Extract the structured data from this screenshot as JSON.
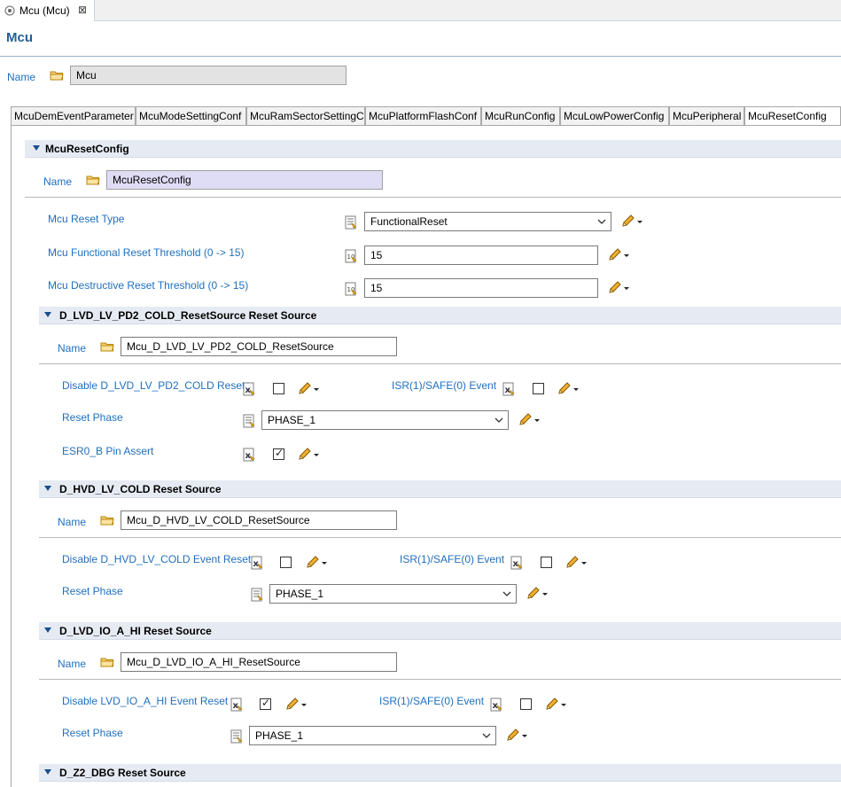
{
  "editor_tab": {
    "title": "Mcu (Mcu)",
    "close_glyph": "⊠"
  },
  "page_title": "Mcu",
  "top_name": {
    "label": "Name",
    "value": "Mcu"
  },
  "subtabs": [
    "McuDemEventParameter",
    "McuModeSettingConf",
    "McuRamSectorSettingC",
    "McuPlatformFlashConf",
    "McuRunConfig",
    "McuLowPowerConfig",
    "McuPeripheral",
    "McuResetConfig"
  ],
  "reset_config": {
    "header": "McuResetConfig",
    "name_label": "Name",
    "name_value": "McuResetConfig",
    "reset_type_label": "Mcu Reset Type",
    "reset_type_value": "FunctionalReset",
    "functional_threshold_label": "Mcu Functional Reset Threshold (0 -> 15)",
    "functional_threshold_value": "15",
    "destructive_threshold_label": "Mcu Destructive Reset Threshold (0 -> 15)",
    "destructive_threshold_value": "15"
  },
  "sections": [
    {
      "header": "D_LVD_LV_PD2_COLD_ResetSource Reset Source",
      "name_label": "Name",
      "name_value": "Mcu_D_LVD_LV_PD2_COLD_ResetSource",
      "disable_label": "Disable D_LVD_LV_PD2_COLD Reset",
      "disable_checked": false,
      "isr_label": "ISR(1)/SAFE(0) Event",
      "isr_checked": false,
      "phase_label": "Reset Phase",
      "phase_value": "PHASE_1",
      "esr_label": "ESR0_B Pin Assert",
      "esr_checked": true
    },
    {
      "header": "D_HVD_LV_COLD Reset Source",
      "name_label": "Name",
      "name_value": "Mcu_D_HVD_LV_COLD_ResetSource",
      "disable_label": "Disable D_HVD_LV_COLD Event Reset",
      "disable_checked": false,
      "isr_label": "ISR(1)/SAFE(0) Event",
      "isr_checked": false,
      "phase_label": "Reset Phase",
      "phase_value": "PHASE_1"
    },
    {
      "header": "D_LVD_IO_A_HI Reset Source",
      "name_label": "Name",
      "name_value": "Mcu_D_LVD_IO_A_HI_ResetSource",
      "disable_label": "Disable LVD_IO_A_HI Event Reset",
      "disable_checked": true,
      "isr_label": "ISR(1)/SAFE(0) Event",
      "isr_checked": false,
      "phase_label": "Reset Phase",
      "phase_value": "PHASE_1"
    },
    {
      "header": "D_Z2_DBG Reset Source"
    }
  ],
  "colors": {
    "label_blue": "#1f6fbf",
    "title_blue": "#1f5f99",
    "header_bg": "#e6ebf3"
  },
  "icons": [
    "mcu-editor-icon",
    "folder-icon",
    "list-config-icon",
    "number-config-icon",
    "boolean-config-icon",
    "pencil-edit-icon",
    "dropdown-arrow-icon",
    "chevron-down-icon",
    "collapse-triangle-icon"
  ]
}
